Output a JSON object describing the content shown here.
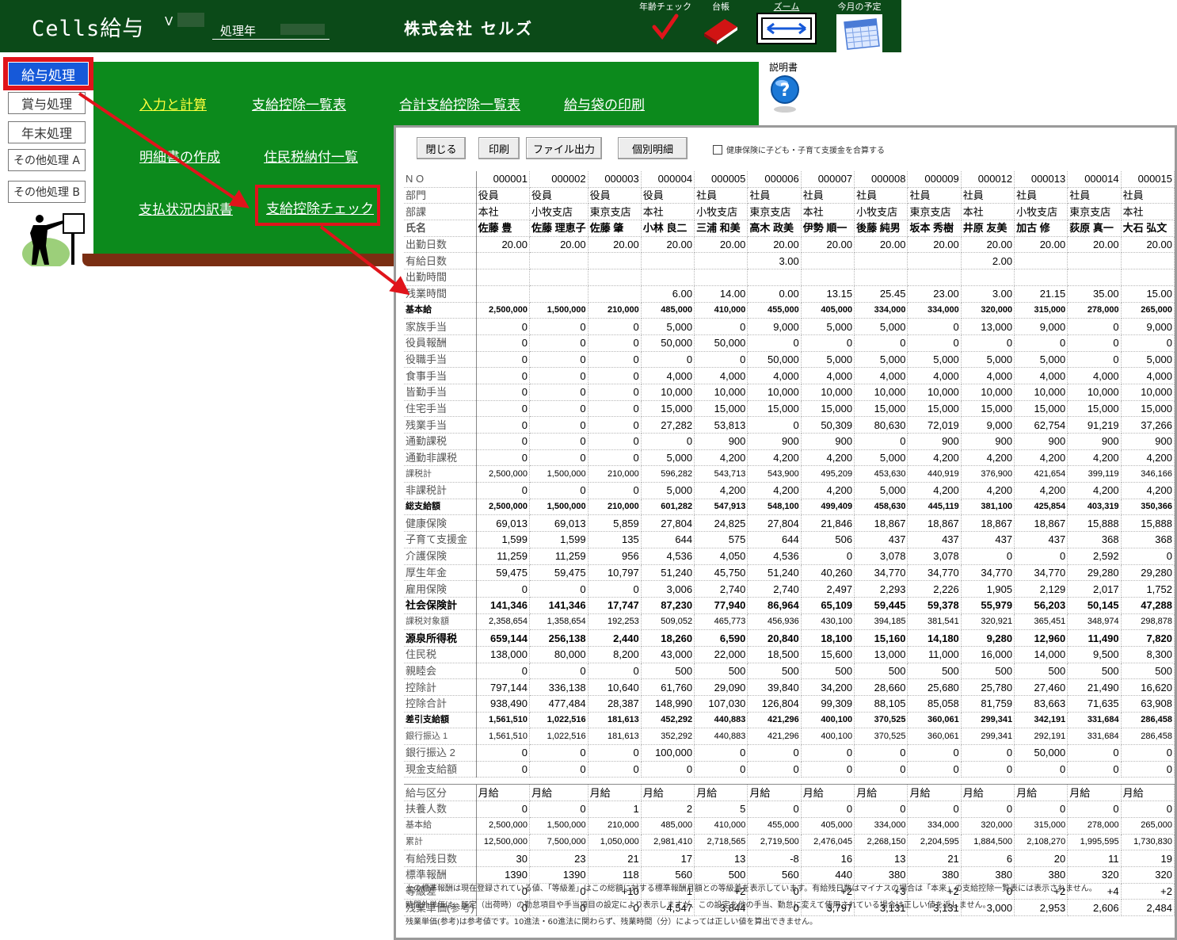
{
  "header": {
    "app_title": "Cells給与",
    "version_prefix": "V",
    "year_label": "処理年",
    "company": "株式会社 セルズ",
    "tools": [
      {
        "label": "年齢チェック",
        "icon": "checkmark-icon"
      },
      {
        "label": "台帳",
        "icon": "ledger-book-icon"
      },
      {
        "label": "ズーム",
        "icon": "zoom-arrows-icon"
      },
      {
        "label": "今月の予定",
        "icon": "calendar-icon"
      }
    ]
  },
  "left_menu": [
    "給与処理",
    "賞与処理",
    "年末処理",
    "その他処理 A",
    "その他処理 B"
  ],
  "panel_links": {
    "input": "入力と計算",
    "list": "支給控除一覧表",
    "total_list": "合計支給控除一覧表",
    "envelope": "給与袋の印刷",
    "statement": "明細書の作成",
    "residence": "住民税納付一覧",
    "status": "支払状況内訳書",
    "check": "支給控除チェック"
  },
  "manual_label": "説明書",
  "dialog": {
    "buttons": {
      "close": "閉じる",
      "print": "印刷",
      "file": "ファイル出力",
      "detail": "個別明細"
    },
    "checkbox_label": "健康保険に子ども・子育て支援金を合算する",
    "employees": {
      "no": [
        "000001",
        "000002",
        "000003",
        "000004",
        "000005",
        "000006",
        "000007",
        "000008",
        "000009",
        "000012",
        "000013",
        "000014",
        "000015"
      ],
      "dept": [
        "役員",
        "役員",
        "役員",
        "役員",
        "社員",
        "社員",
        "社員",
        "社員",
        "社員",
        "社員",
        "社員",
        "社員",
        "社員"
      ],
      "section": [
        "本社",
        "小牧支店",
        "東京支店",
        "本社",
        "小牧支店",
        "東京支店",
        "本社",
        "小牧支店",
        "東京支店",
        "本社",
        "小牧支店",
        "東京支店",
        "本社"
      ],
      "name": [
        "佐藤 豊",
        "佐藤 理恵子",
        "佐藤 肇",
        "小林 良二",
        "三浦 和美",
        "高木 政美",
        "伊勢 順一",
        "後藤 純男",
        "坂本 秀樹",
        "井原 友美",
        "加古 修",
        "荻原 真一",
        "大石 弘文"
      ]
    },
    "header_labels": {
      "no": "N O",
      "dept": "部門",
      "section": "部課",
      "name": "氏名"
    },
    "rows": [
      {
        "label": "出勤日数",
        "values": [
          "20.00",
          "20.00",
          "20.00",
          "20.00",
          "20.00",
          "20.00",
          "20.00",
          "20.00",
          "20.00",
          "20.00",
          "20.00",
          "20.00",
          "20.00"
        ]
      },
      {
        "label": "有給日数",
        "values": [
          "",
          "",
          "",
          "",
          "",
          "3.00",
          "",
          "",
          "",
          "2.00",
          "",
          "",
          ""
        ]
      },
      {
        "label": "出勤時間",
        "values": [
          "",
          "",
          "",
          "",
          "",
          "",
          "",
          "",
          "",
          "",
          "",
          "",
          ""
        ]
      },
      {
        "label": "残業時間",
        "values": [
          "",
          "",
          "",
          "6.00",
          "14.00",
          "0.00",
          "13.15",
          "25.45",
          "23.00",
          "3.00",
          "21.15",
          "35.00",
          "15.00"
        ]
      },
      {
        "label": "基本給",
        "style": "bold small",
        "values": [
          "2,500,000",
          "1,500,000",
          "210,000",
          "485,000",
          "410,000",
          "455,000",
          "405,000",
          "334,000",
          "334,000",
          "320,000",
          "315,000",
          "278,000",
          "265,000"
        ]
      },
      {
        "label": "家族手当",
        "values": [
          "0",
          "0",
          "0",
          "5,000",
          "0",
          "9,000",
          "5,000",
          "5,000",
          "0",
          "13,000",
          "9,000",
          "0",
          "9,000"
        ]
      },
      {
        "label": "役員報酬",
        "values": [
          "0",
          "0",
          "0",
          "50,000",
          "50,000",
          "0",
          "0",
          "0",
          "0",
          "0",
          "0",
          "0",
          "0"
        ]
      },
      {
        "label": "役職手当",
        "values": [
          "0",
          "0",
          "0",
          "0",
          "0",
          "50,000",
          "5,000",
          "5,000",
          "5,000",
          "5,000",
          "5,000",
          "0",
          "5,000"
        ]
      },
      {
        "label": "食事手当",
        "values": [
          "0",
          "0",
          "0",
          "4,000",
          "4,000",
          "4,000",
          "4,000",
          "4,000",
          "4,000",
          "4,000",
          "4,000",
          "4,000",
          "4,000"
        ]
      },
      {
        "label": "皆勤手当",
        "values": [
          "0",
          "0",
          "0",
          "10,000",
          "10,000",
          "10,000",
          "10,000",
          "10,000",
          "10,000",
          "10,000",
          "10,000",
          "10,000",
          "10,000"
        ]
      },
      {
        "label": "住宅手当",
        "values": [
          "0",
          "0",
          "0",
          "15,000",
          "15,000",
          "15,000",
          "15,000",
          "15,000",
          "15,000",
          "15,000",
          "15,000",
          "15,000",
          "15,000"
        ]
      },
      {
        "label": "残業手当",
        "values": [
          "0",
          "0",
          "0",
          "27,282",
          "53,813",
          "0",
          "50,309",
          "80,630",
          "72,019",
          "9,000",
          "62,754",
          "91,219",
          "37,266"
        ]
      },
      {
        "label": "通勤課税",
        "values": [
          "0",
          "0",
          "0",
          "0",
          "900",
          "900",
          "900",
          "0",
          "900",
          "900",
          "900",
          "900",
          "900"
        ]
      },
      {
        "label": "通勤非課税",
        "values": [
          "0",
          "0",
          "0",
          "5,000",
          "4,200",
          "4,200",
          "4,200",
          "5,000",
          "4,200",
          "4,200",
          "4,200",
          "4,200",
          "4,200"
        ]
      },
      {
        "label": "課税計",
        "style": "small",
        "values": [
          "2,500,000",
          "1,500,000",
          "210,000",
          "596,282",
          "543,713",
          "543,900",
          "495,209",
          "453,630",
          "440,919",
          "376,900",
          "421,654",
          "399,119",
          "346,166"
        ]
      },
      {
        "label": "非課税計",
        "values": [
          "0",
          "0",
          "0",
          "5,000",
          "4,200",
          "4,200",
          "4,200",
          "5,000",
          "4,200",
          "4,200",
          "4,200",
          "4,200",
          "4,200"
        ]
      },
      {
        "label": "総支給額",
        "style": "bold small",
        "values": [
          "2,500,000",
          "1,500,000",
          "210,000",
          "601,282",
          "547,913",
          "548,100",
          "499,409",
          "458,630",
          "445,119",
          "381,100",
          "425,854",
          "403,319",
          "350,366"
        ]
      },
      {
        "label": "健康保険",
        "values": [
          "69,013",
          "69,013",
          "5,859",
          "27,804",
          "24,825",
          "27,804",
          "21,846",
          "18,867",
          "18,867",
          "18,867",
          "18,867",
          "15,888",
          "15,888"
        ]
      },
      {
        "label": "子育て支援金",
        "values": [
          "1,599",
          "1,599",
          "135",
          "644",
          "575",
          "644",
          "506",
          "437",
          "437",
          "437",
          "437",
          "368",
          "368"
        ]
      },
      {
        "label": "介護保険",
        "values": [
          "11,259",
          "11,259",
          "956",
          "4,536",
          "4,050",
          "4,536",
          "0",
          "3,078",
          "3,078",
          "0",
          "0",
          "2,592",
          "0"
        ]
      },
      {
        "label": "厚生年金",
        "values": [
          "59,475",
          "59,475",
          "10,797",
          "51,240",
          "45,750",
          "51,240",
          "40,260",
          "34,770",
          "34,770",
          "34,770",
          "34,770",
          "29,280",
          "29,280"
        ]
      },
      {
        "label": "雇用保険",
        "values": [
          "0",
          "0",
          "0",
          "3,006",
          "2,740",
          "2,740",
          "2,497",
          "2,293",
          "2,226",
          "1,905",
          "2,129",
          "2,017",
          "1,752"
        ]
      },
      {
        "label": "社会保険計",
        "style": "bold",
        "values": [
          "141,346",
          "141,346",
          "17,747",
          "87,230",
          "77,940",
          "86,964",
          "65,109",
          "59,445",
          "59,378",
          "55,979",
          "56,203",
          "50,145",
          "47,288"
        ]
      },
      {
        "label": "課税対象額",
        "style": "small",
        "values": [
          "2,358,654",
          "1,358,654",
          "192,253",
          "509,052",
          "465,773",
          "456,936",
          "430,100",
          "394,185",
          "381,541",
          "320,921",
          "365,451",
          "348,974",
          "298,878"
        ]
      },
      {
        "label": "源泉所得税",
        "style": "bold",
        "values": [
          "659,144",
          "256,138",
          "2,440",
          "18,260",
          "6,590",
          "20,840",
          "18,100",
          "15,160",
          "14,180",
          "9,280",
          "12,960",
          "11,490",
          "7,820"
        ]
      },
      {
        "label": "住民税",
        "values": [
          "138,000",
          "80,000",
          "8,200",
          "43,000",
          "22,000",
          "18,500",
          "15,600",
          "13,000",
          "11,000",
          "16,000",
          "14,000",
          "9,500",
          "8,300"
        ]
      },
      {
        "label": "親睦会",
        "values": [
          "0",
          "0",
          "0",
          "500",
          "500",
          "500",
          "500",
          "500",
          "500",
          "500",
          "500",
          "500",
          "500"
        ]
      },
      {
        "label": "控除計",
        "values": [
          "797,144",
          "336,138",
          "10,640",
          "61,760",
          "29,090",
          "39,840",
          "34,200",
          "28,660",
          "25,680",
          "25,780",
          "27,460",
          "21,490",
          "16,620"
        ]
      },
      {
        "label": "控除合計",
        "values": [
          "938,490",
          "477,484",
          "28,387",
          "148,990",
          "107,030",
          "126,804",
          "99,309",
          "88,105",
          "85,058",
          "81,759",
          "83,663",
          "71,635",
          "63,908"
        ]
      },
      {
        "label": "差引支給額",
        "style": "bold small",
        "values": [
          "1,561,510",
          "1,022,516",
          "181,613",
          "452,292",
          "440,883",
          "421,296",
          "400,100",
          "370,525",
          "360,061",
          "299,341",
          "342,191",
          "331,684",
          "286,458"
        ]
      },
      {
        "label": "銀行振込 1",
        "style": "small",
        "values": [
          "1,561,510",
          "1,022,516",
          "181,613",
          "352,292",
          "440,883",
          "421,296",
          "400,100",
          "370,525",
          "360,061",
          "299,341",
          "292,191",
          "331,684",
          "286,458"
        ]
      },
      {
        "label": "銀行振込 2",
        "values": [
          "0",
          "0",
          "0",
          "100,000",
          "0",
          "0",
          "0",
          "0",
          "0",
          "0",
          "50,000",
          "0",
          "0"
        ]
      },
      {
        "label": "現金支給額",
        "values": [
          "0",
          "0",
          "0",
          "0",
          "0",
          "0",
          "0",
          "0",
          "0",
          "0",
          "0",
          "0",
          "0"
        ]
      }
    ],
    "rows2": [
      {
        "label": "給与区分",
        "align": "left",
        "values": [
          "月給",
          "月給",
          "月給",
          "月給",
          "月給",
          "月給",
          "月給",
          "月給",
          "月給",
          "月給",
          "月給",
          "月給",
          "月給"
        ]
      },
      {
        "label": "扶養人数",
        "values": [
          "0",
          "0",
          "1",
          "2",
          "5",
          "0",
          "0",
          "0",
          "0",
          "0",
          "0",
          "0",
          "0"
        ]
      },
      {
        "label": "基本給",
        "style": "small",
        "values": [
          "2,500,000",
          "1,500,000",
          "210,000",
          "485,000",
          "410,000",
          "455,000",
          "405,000",
          "334,000",
          "334,000",
          "320,000",
          "315,000",
          "278,000",
          "265,000"
        ]
      },
      {
        "label": "累計",
        "style": "small",
        "values": [
          "12,500,000",
          "7,500,000",
          "1,050,000",
          "2,981,410",
          "2,718,565",
          "2,719,500",
          "2,476,045",
          "2,268,150",
          "2,204,595",
          "1,884,500",
          "2,108,270",
          "1,995,595",
          "1,730,830"
        ]
      },
      {
        "label": "有給残日数",
        "values": [
          "30",
          "23",
          "21",
          "17",
          "13",
          "-8",
          "16",
          "13",
          "21",
          "6",
          "20",
          "11",
          "19"
        ]
      },
      {
        "label": "標準報酬",
        "values": [
          "1390",
          "1390",
          "118",
          "560",
          "500",
          "560",
          "440",
          "380",
          "380",
          "380",
          "380",
          "320",
          "320"
        ]
      },
      {
        "label": "等級差",
        "values": [
          "0",
          "0",
          "+10",
          "1",
          "+2",
          "0",
          "+2",
          "+3",
          "+2",
          "0",
          "+2",
          "+4",
          "+2"
        ]
      },
      {
        "label": "残業単価(参考)",
        "values": [
          "0",
          "0",
          "0",
          "4,547",
          "3,844",
          "0",
          "3,797",
          "3,131",
          "3,131",
          "3,000",
          "2,953",
          "2,606",
          "2,484"
        ]
      }
    ],
    "notes": [
      "上の標準報酬は現在登録されている値、「等級差」はこの総額に対する標準報酬月額との等級差を表示しています。有給残日数はマイナスの場合は「本来」の支給控除一覧表には表示されません。",
      "時間外単価は、既定（出荷時）の勤怠項目や手当項目の設定により表示しますが、この設定を他の手当、勤怠に変えて使用されている場合は正しい値を返しません。",
      "残業単価(参考)は参考値です。10進法・60進法に関わらず、残業時間（分）によっては正しい値を算出できません。"
    ]
  },
  "colors": {
    "header_bg": "#0b4a18",
    "panel_bg": "#0c8a1c",
    "highlight_red": "#e0141b",
    "menu_blue": "#1659d9"
  }
}
